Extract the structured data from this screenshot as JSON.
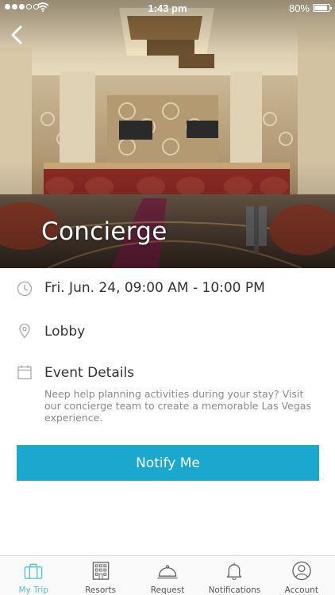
{
  "status_bar": {
    "time": "1:43 pm",
    "battery": "80%"
  },
  "hero": {
    "title": "Concierge"
  },
  "event": {
    "schedule": "Fri. Jun. 24, 09:00 AM - 10:00 PM",
    "location": "Lobby",
    "details_label": "Event Details",
    "details_text": "Neep help planning activities during your stay? Visit our concierge team to create a memorable Las Vegas experience."
  },
  "actions": {
    "notify_label": "Notify Me"
  },
  "tabs": [
    {
      "label": "My Trip",
      "icon": "suitcase-icon",
      "active": true
    },
    {
      "label": "Resorts",
      "icon": "building-icon",
      "active": false
    },
    {
      "label": "Request",
      "icon": "cloche-icon",
      "active": false
    },
    {
      "label": "Notifications",
      "icon": "bell-icon",
      "active": false
    },
    {
      "label": "Account",
      "icon": "user-icon",
      "active": false
    }
  ],
  "colors": {
    "accent": "#1aa8cf",
    "active_tab": "#4fc3c8",
    "icon_gray": "#a8a8a8"
  }
}
